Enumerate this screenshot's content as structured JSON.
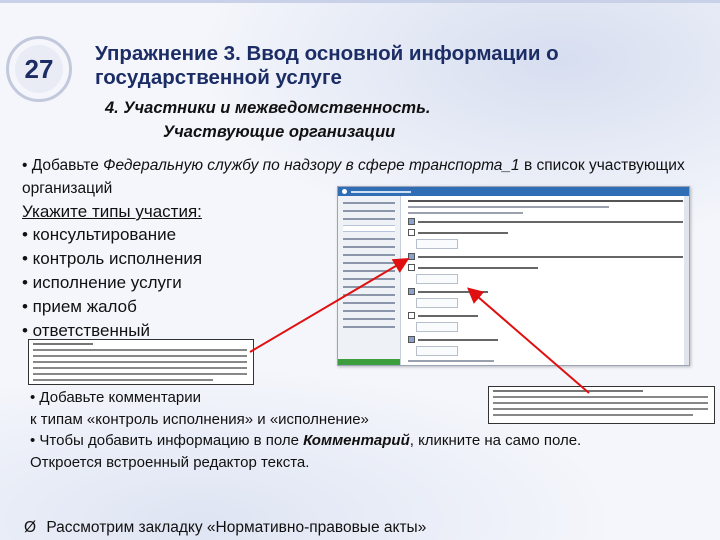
{
  "slide": {
    "number": "27",
    "title": "Упражнение 3. Ввод основной информации о государственной услуге",
    "subtitle_line1": "4. Участники и межведомственность.",
    "subtitle_line2": "Участвующие организации"
  },
  "bullet1": {
    "prefix": "• Добавьте ",
    "italic": "Федеральную службу по надзору в сфере транспорта_1",
    "suffix": " в список участвующих организаций"
  },
  "participation": {
    "heading": "Укажите типы участия:",
    "items": [
      "• консультирование",
      "• контроль исполнения",
      "• исполнение услуги",
      "• прием жалоб",
      "• ответственный"
    ]
  },
  "bullet3": {
    "line1": "• Добавьте комментарии",
    "line2": "к типам «контроль исполнения» и «исполнение»",
    "line3_prefix": "• Чтобы добавить информацию в поле ",
    "line3_bold": "Комментарий",
    "line3_suffix": ", кликните на само поле.",
    "line4": "Откроется встроенный редактор текста."
  },
  "bullet4": {
    "marker": "Ø",
    "text": "Рассмотрим закладку «Нормативно-правовые акты»"
  },
  "colors": {
    "title": "#1c2d66",
    "arrow": "#e01010",
    "screenshot_header": "#2f6db5",
    "screenshot_accent": "#3c9d3c"
  }
}
